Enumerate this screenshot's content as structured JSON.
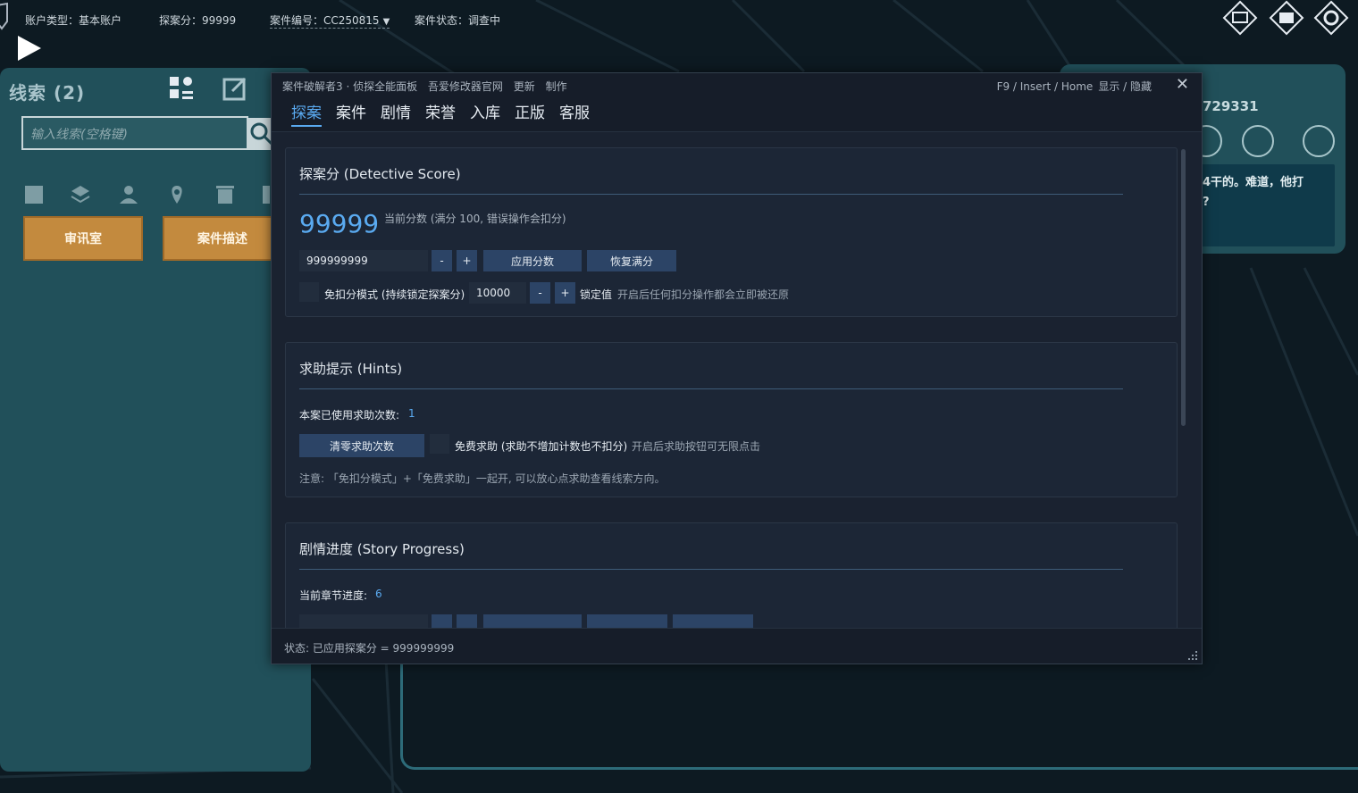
{
  "topbar": {
    "account_type": "账户类型：基本账户",
    "score": "探案分：99999",
    "case_no": "案件编号：CC250815",
    "case_state": "案件状态：调查中"
  },
  "left_panel": {
    "title": "线索 (2)",
    "search_placeholder": "输入线索(空格键)",
    "btn_interrogation": "审讯室",
    "btn_case_desc": "案件描述"
  },
  "right_panel": {
    "number": "729331",
    "dialog_line1": "4干的。难道，他打",
    "dialog_line2": "?"
  },
  "dialog": {
    "meta": [
      "案件破解者3 · 侦探全能面板",
      "吾爱修改器官网",
      "更新",
      "制作"
    ],
    "hotkey": "F9 / Insert / Home",
    "toggle_label": "显示 / 隐藏",
    "close_icon": "close-icon",
    "tabs": [
      "探案",
      "案件",
      "剧情",
      "荣誉",
      "入库",
      "正版",
      "客服"
    ],
    "active_tab": "探案",
    "score_section": {
      "title": "探案分 (Detective Score)",
      "value": "99999",
      "note": "当前分数 (满分 100, 错误操作会扣分)",
      "input_value": "999999999",
      "minus": "-",
      "plus": "+",
      "apply_btn": "应用分数",
      "restore_btn": "恢复满分",
      "nodeduct_label": "免扣分模式 (持续锁定探案分)",
      "lock_value": "10000",
      "lock_label": "锁定值",
      "lock_note": "开启后任何扣分操作都会立即被还原"
    },
    "hints_section": {
      "title": "求助提示 (Hints)",
      "used_label": "本案已使用求助次数:",
      "used_value": "1",
      "clear_btn": "清零求助次数",
      "free_label": "免费求助 (求助不增加计数也不扣分)",
      "free_note": "开启后求助按钮可无限点击",
      "tip": "注意: 「免扣分模式」+「免费求助」一起开, 可以放心点求助查看线索方向。"
    },
    "story_section": {
      "title": "剧情进度 (Story Progress)",
      "chapter_label": "当前章节进度:",
      "chapter_value": "6"
    },
    "status": "状态: 已应用探案分 = 999999999"
  },
  "colors": {
    "accent": "#5aaaf0",
    "panel_teal": "#21505a",
    "button_orange": "#c38a3e",
    "dialog_bg": "#1a2230"
  }
}
